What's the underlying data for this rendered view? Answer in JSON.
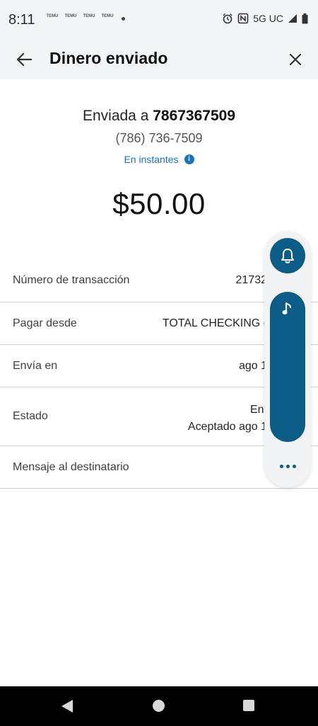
{
  "status_bar": {
    "time": "8:11",
    "notifications": [
      "TEMU",
      "TEMU",
      "TEMU",
      "TEMU"
    ],
    "network": "5G UC",
    "icons": [
      "alarm-icon",
      "nfc-icon",
      "signal-icon",
      "battery-icon"
    ]
  },
  "header": {
    "title": "Dinero enviado",
    "back_icon": "back-arrow-icon",
    "close_icon": "close-icon"
  },
  "summary": {
    "sent_prefix": "Enviada a ",
    "recipient": "7867367509",
    "phone": "(786) 736-7509",
    "timing": "En instantes",
    "info_icon": "i",
    "amount": "$50.00"
  },
  "details": [
    {
      "label": "Número de transacción",
      "value": [
        "21732"
      ]
    },
    {
      "label": "Pagar desde",
      "value": [
        "TOTAL CHECKING ("
      ]
    },
    {
      "label": "Envía en",
      "value": [
        "ago 1"
      ]
    },
    {
      "label": "Estado",
      "value": [
        "Ent",
        "Aceptado ago 1"
      ]
    },
    {
      "label": "Mensaje al destinatario",
      "value": [
        ""
      ]
    }
  ],
  "side_panel": {
    "icons": [
      "bell-icon",
      "music-note-icon",
      "more-dots-icon"
    ],
    "accent": "#0c5c88"
  },
  "colors": {
    "header_bg": "#f4f5f7",
    "link": "#1a73b8",
    "divider": "#cfd3d8"
  }
}
